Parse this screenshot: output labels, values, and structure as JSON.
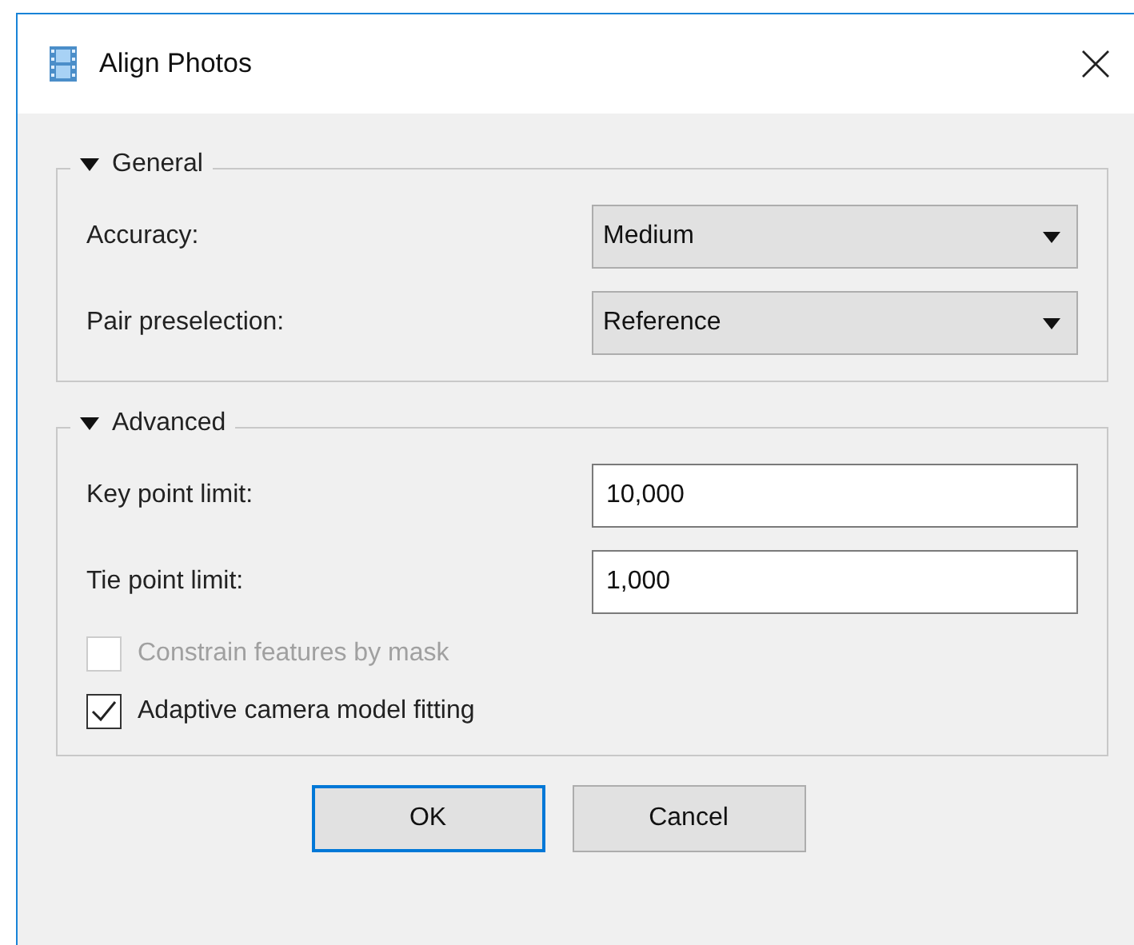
{
  "window": {
    "title": "Align Photos"
  },
  "groups": [
    {
      "title": "General",
      "expanded": true,
      "fields": [
        {
          "kind": "combo",
          "label": "Accuracy:",
          "value": "Medium"
        },
        {
          "kind": "combo",
          "label": "Pair preselection:",
          "value": "Reference"
        }
      ]
    },
    {
      "title": "Advanced",
      "expanded": true,
      "fields": [
        {
          "kind": "input",
          "label": "Key point limit:",
          "value": "10,000"
        },
        {
          "kind": "input",
          "label": "Tie point limit:",
          "value": "1,000"
        }
      ],
      "options": [
        {
          "label": "Constrain features by mask",
          "checked": false,
          "disabled": true
        },
        {
          "label": "Adaptive camera model fitting",
          "checked": true,
          "disabled": false
        }
      ]
    }
  ],
  "buttons": [
    {
      "label": "OK",
      "default": true
    },
    {
      "label": "Cancel",
      "default": false
    }
  ]
}
